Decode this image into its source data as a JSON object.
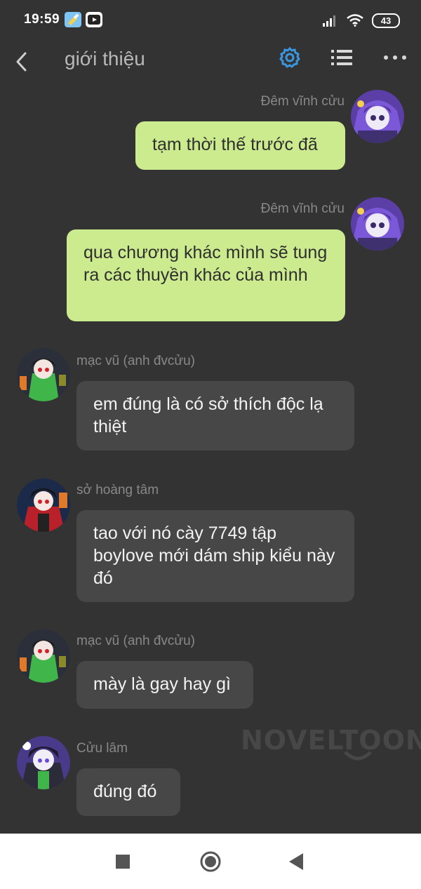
{
  "status_bar": {
    "time": "19:59",
    "battery": "43",
    "icons": [
      "cleaner-app-icon",
      "video-app-icon",
      "signal-icon",
      "wifi-icon",
      "battery-icon"
    ]
  },
  "header": {
    "title": "giới thiệu",
    "icons": [
      "back-arrow-icon",
      "settings-gear-icon",
      "list-icon",
      "more-icon"
    ],
    "accent": "#3b96e0"
  },
  "messages": [
    {
      "sender": "Đêm vĩnh cửu",
      "side": "right",
      "text": "tạm thời thế trước đã"
    },
    {
      "sender": "Đêm vĩnh cửu",
      "side": "right",
      "text": "qua chương khác mình sẽ tung ra các thuyền khác của mình"
    },
    {
      "sender": "mạc vũ (anh đvcửu)",
      "side": "left",
      "text": "em đúng là có sở thích độc lạ thiệt"
    },
    {
      "sender": "sở hoàng tâm",
      "side": "left",
      "text": "tao với nó cày 7749 tập boylove mới dám ship kiểu này đó"
    },
    {
      "sender": "mạc vũ (anh đvcửu)",
      "side": "left",
      "text": "mày là gay hay gì"
    },
    {
      "sender": "Cửu lâm",
      "side": "left",
      "text": "đúng đó"
    }
  ],
  "watermark": "NOVELTOON",
  "colors": {
    "background": "#333333",
    "my_bubble": "#cbeb8e",
    "other_bubble": "#474747",
    "sender_name": "#888888",
    "nav_bar": "#ffffff"
  },
  "nav_bar": {
    "icons": [
      "recents-square-icon",
      "home-circle-icon",
      "back-triangle-icon"
    ]
  }
}
